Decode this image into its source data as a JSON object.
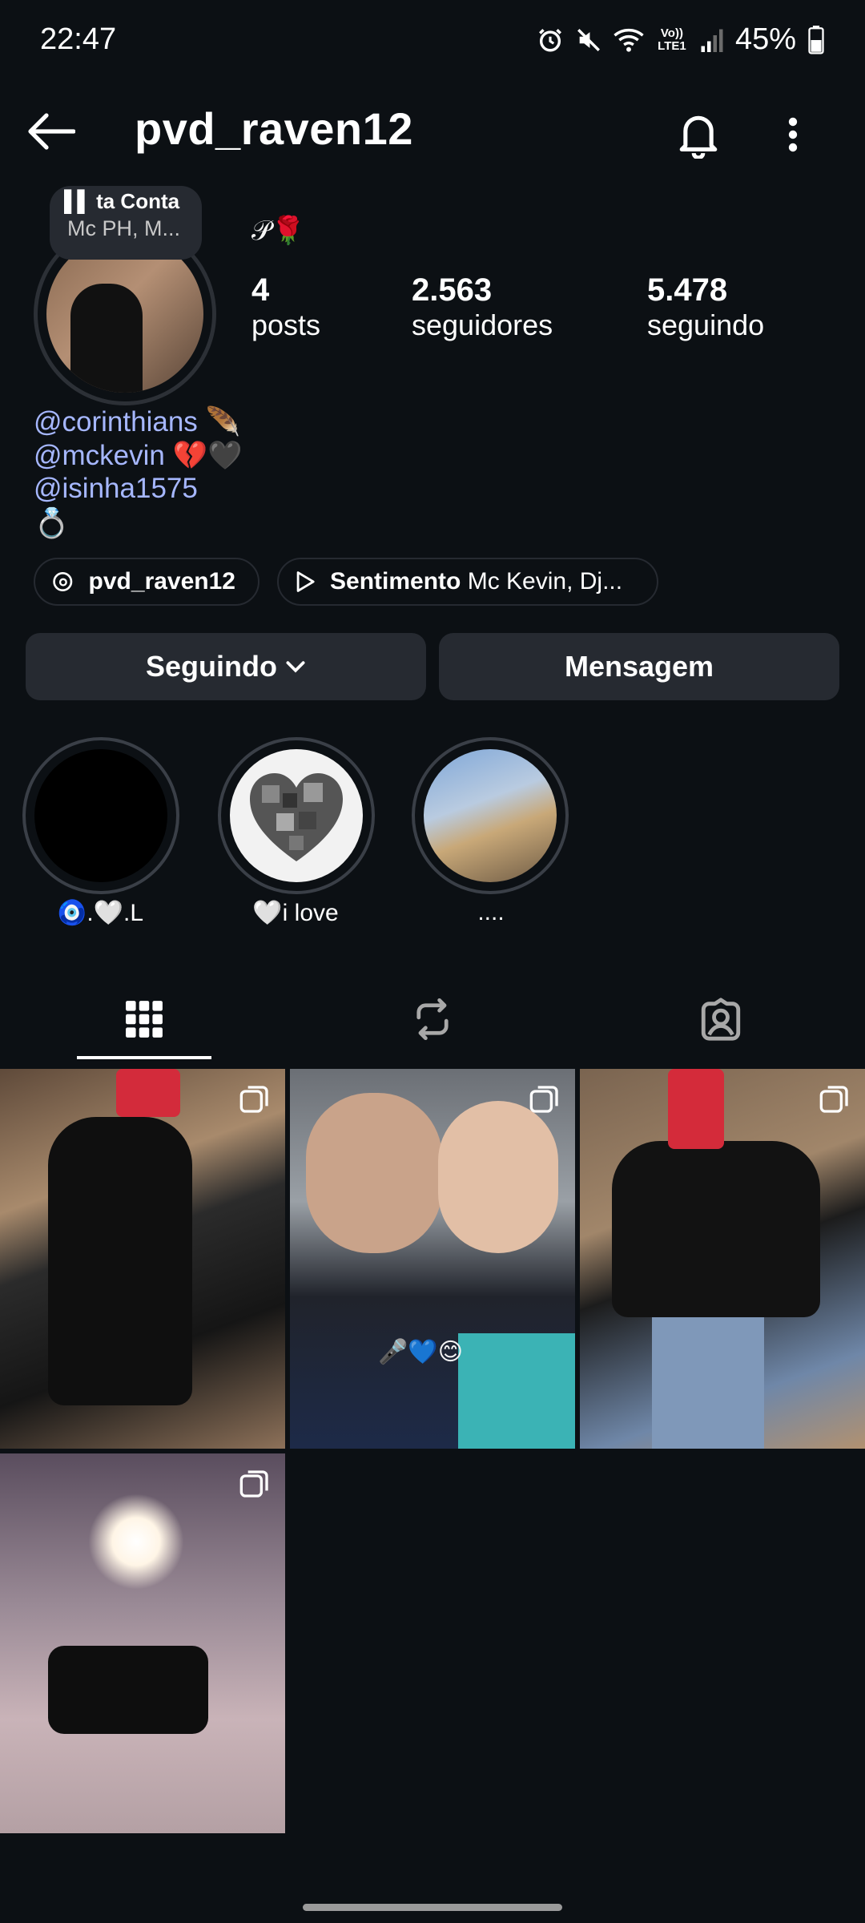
{
  "status_bar": {
    "time": "22:47",
    "network_label": "Vo)) LTE1",
    "battery": "45%"
  },
  "header": {
    "username": "pvd_raven12"
  },
  "note": {
    "line1": "ta Conta",
    "line2": "Mc PH, M..."
  },
  "profile": {
    "emoji": "𝒫🌹",
    "stats": [
      {
        "value": "4",
        "label": "posts"
      },
      {
        "value": "2.563",
        "label": "seguidores"
      },
      {
        "value": "5.478",
        "label": "seguindo"
      }
    ],
    "bio": [
      "@corinthians 🪶",
      "@mckevin 💔🖤",
      "@isinha1575"
    ],
    "bio_last": "💍"
  },
  "chips": {
    "threads": "pvd_raven12",
    "music_title": "Sentimento",
    "music_artist": "Mc Kevin, Dj..."
  },
  "buttons": {
    "following": "Seguindo",
    "message": "Mensagem"
  },
  "highlights": [
    {
      "label": "🧿.🤍.L"
    },
    {
      "label": "🤍i love"
    },
    {
      "label": "...."
    }
  ],
  "tabs": [
    "grid-icon",
    "reposts-icon",
    "tagged-icon"
  ],
  "posts": [
    {
      "multi": true
    },
    {
      "multi": true,
      "caption": "🎤💙😊"
    },
    {
      "multi": true
    },
    {
      "multi": true
    }
  ],
  "colors": {
    "background": "#0c1014",
    "button": "#262a31",
    "link": "#a6b7ff"
  }
}
